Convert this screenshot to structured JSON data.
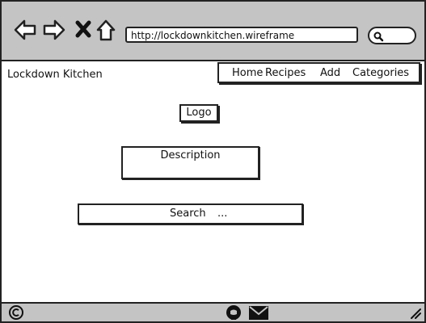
{
  "browser": {
    "url": "http://lockdownkitchen.wireframe",
    "icons": [
      "back-arrow-icon",
      "forward-arrow-icon",
      "close-icon",
      "home-icon",
      "search-icon"
    ]
  },
  "header": {
    "brand": "Lockdown Kitchen",
    "nav": [
      {
        "label": "Home"
      },
      {
        "label": "Recipes"
      },
      {
        "label": "Add"
      },
      {
        "label": "Categories"
      }
    ]
  },
  "main": {
    "logo_label": "Logo",
    "description_label": "Description",
    "search_label": "Search",
    "search_placeholder": "..."
  },
  "footer": {
    "icons": [
      "copyright-icon",
      "github-icon",
      "mail-icon",
      "resize-handle-icon"
    ]
  }
}
